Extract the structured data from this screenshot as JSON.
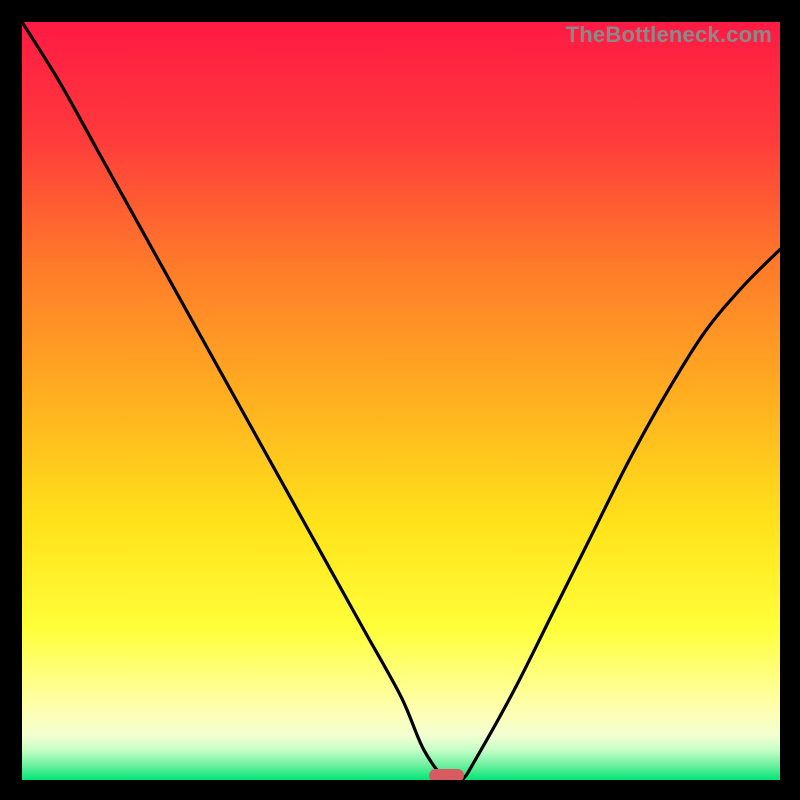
{
  "watermark": "TheBottleneck.com",
  "colors": {
    "background": "#000000",
    "gradient_top": "#ff1a44",
    "gradient_mid_upper": "#ff6a2f",
    "gradient_mid": "#ffd21f",
    "gradient_lower": "#ffff4d",
    "gradient_pale": "#ffffbf",
    "gradient_bottom": "#00e676",
    "curve": "#000000",
    "marker": "#d95b62"
  },
  "chart_data": {
    "type": "line",
    "title": "",
    "xlabel": "",
    "ylabel": "",
    "xlim": [
      0,
      100
    ],
    "ylim": [
      0,
      100
    ],
    "series": [
      {
        "name": "bottleneck-curve",
        "x": [
          0,
          5,
          10,
          15,
          20,
          25,
          30,
          35,
          40,
          45,
          50,
          53,
          56,
          58,
          60,
          65,
          70,
          75,
          80,
          85,
          90,
          95,
          100
        ],
        "values": [
          100,
          92,
          83,
          74,
          65,
          56,
          47,
          38,
          29,
          20,
          11,
          4,
          0,
          0,
          3,
          12,
          22,
          32,
          42,
          51,
          59,
          65,
          70
        ]
      }
    ],
    "marker": {
      "x": 56,
      "y": 0
    }
  }
}
